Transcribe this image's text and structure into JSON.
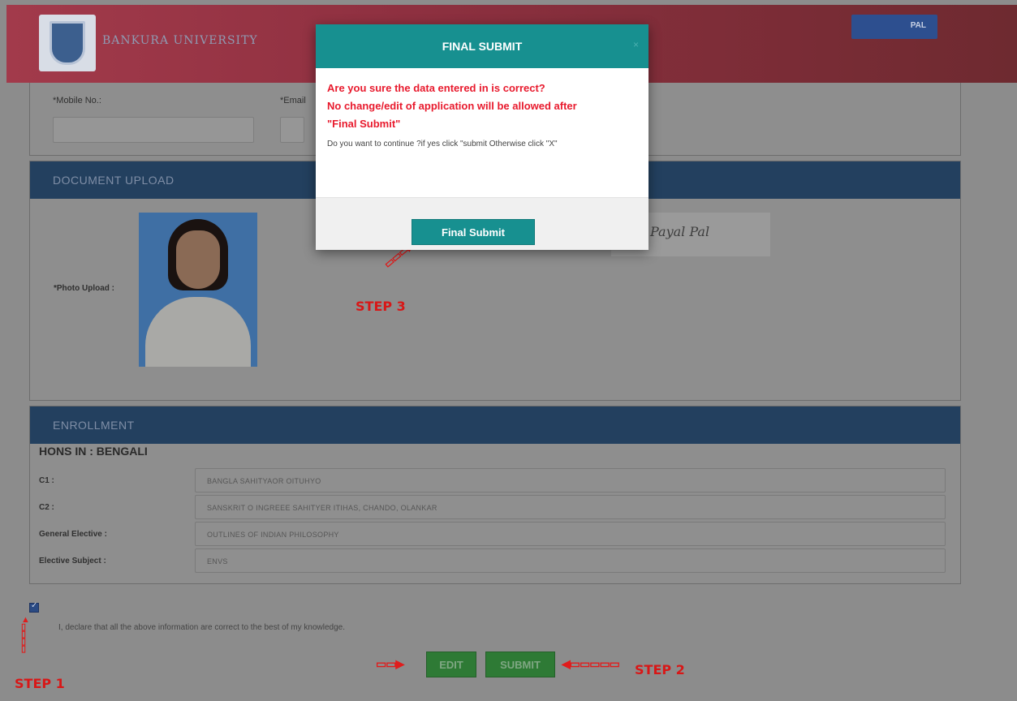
{
  "header": {
    "brand": "BANKURA UNIVERSITY",
    "user_button": "PAL"
  },
  "contact": {
    "mobile_label": "*Mobile No.:",
    "email_label": "*Email"
  },
  "documents": {
    "section_title": "DOCUMENT UPLOAD",
    "photo_label": "*Photo Upload :",
    "signature_text": "Payal Pal"
  },
  "enrollment": {
    "section_title": "ENROLLMENT",
    "hons_title": "HONS IN : BENGALI",
    "rows": [
      {
        "label": "C1 :",
        "value": "BANGLA SAHITYAOR OITUHYO"
      },
      {
        "label": "C2 :",
        "value": "SANSKRIT O INGREEE SAHITYER ITIHAS, CHANDO, OLANKAR"
      },
      {
        "label": "General Elective :",
        "value": "OUTLINES OF INDIAN PHILOSOPHY"
      },
      {
        "label": "Elective Subject :",
        "value": "ENVS"
      }
    ]
  },
  "declaration": {
    "text": "I, declare that all the above information are correct to the best of my knowledge.",
    "checked": true
  },
  "buttons": {
    "edit": "EDIT",
    "submit": "SUBMIT"
  },
  "annotations": {
    "step1": "STEP 1",
    "step2": "STEP 2",
    "step3": "STEP 3"
  },
  "modal": {
    "title": "FINAL SUBMIT",
    "close": "×",
    "warning_line1": "Are you sure the data entered in is correct?",
    "warning_line2": "No change/edit of application will be allowed after",
    "warning_line3": "\"Final Submit\"",
    "message": "Do you want to continue ?if yes click \"submit Otherwise click \"X\"",
    "button": "Final Submit"
  },
  "colors": {
    "modal_accent": "#179090",
    "warning": "#e81a2d",
    "section_header": "#23405f",
    "button_green": "#2e7a35"
  }
}
